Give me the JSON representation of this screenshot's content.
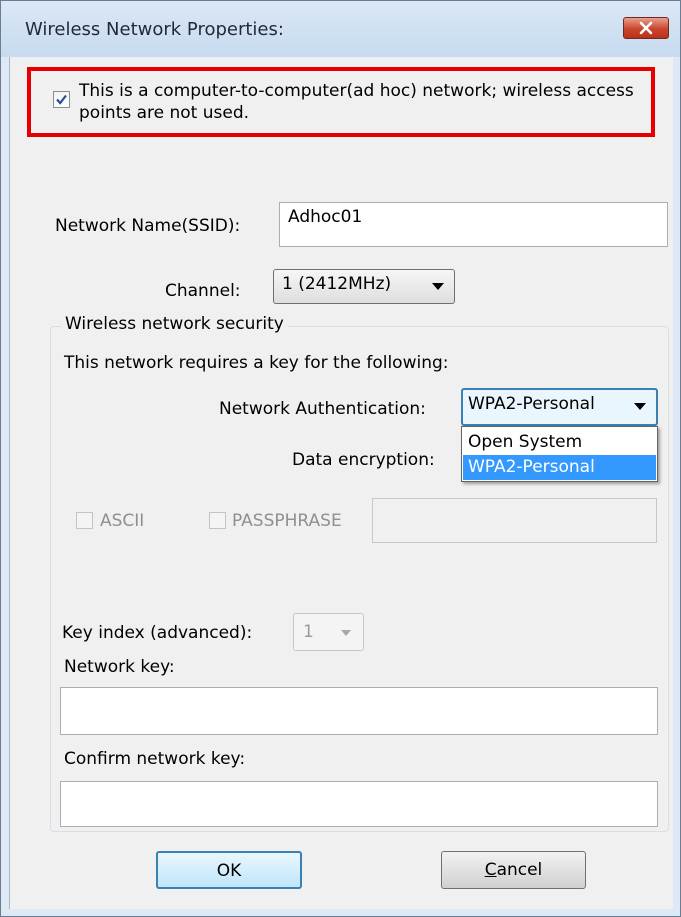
{
  "window": {
    "title": "Wireless Network Properties:",
    "close_icon": "close-icon"
  },
  "adhoc": {
    "checked": true,
    "label": "This is a computer-to-computer(ad hoc) network; wireless access points are not used."
  },
  "network_name": {
    "label": "Network Name(SSID):",
    "value": "Adhoc01"
  },
  "channel": {
    "label": "Channel:",
    "value": "1  (2412MHz)"
  },
  "security": {
    "group_title": "Wireless network security",
    "requirement_text": "This network requires a key for the following:",
    "auth_label": "Network Authentication:",
    "auth_value": "WPA2-Personal",
    "auth_options": [
      "Open System",
      "WPA2-Personal"
    ],
    "encryption_label": "Data encryption:",
    "ascii_label": "ASCII",
    "passphrase_label": "PASSPHRASE"
  },
  "key": {
    "index_label": "Key index (advanced):",
    "index_value": "1",
    "network_key_label": "Network key:",
    "network_key_value": "",
    "confirm_label": "Confirm network key:",
    "confirm_value": ""
  },
  "buttons": {
    "ok": "OK",
    "cancel_prefix": "C",
    "cancel_rest": "ancel"
  },
  "colors": {
    "highlight_border": "#e60000",
    "selection": "#3399ff"
  }
}
